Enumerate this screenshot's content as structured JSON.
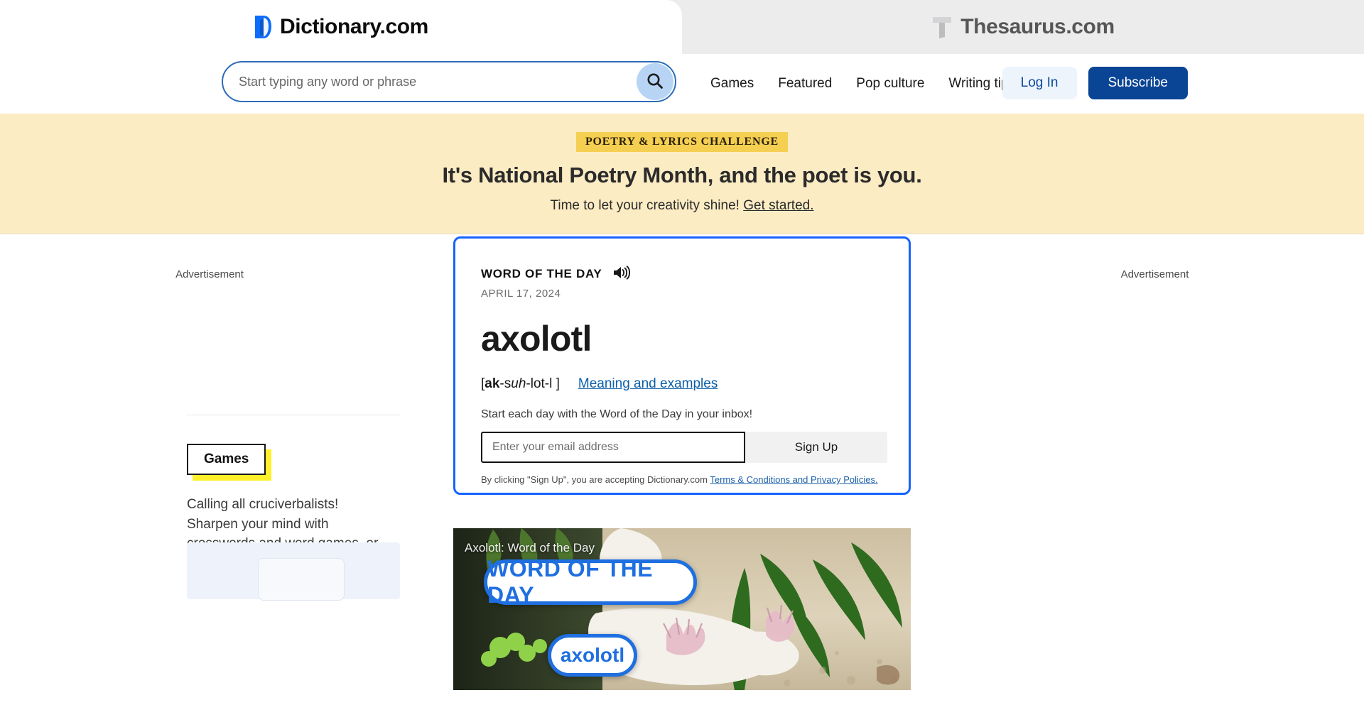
{
  "tabs": [
    {
      "label": "Dictionary.com",
      "icon": "dictionary-logo-icon",
      "active": true
    },
    {
      "label": "Thesaurus.com",
      "icon": "thesaurus-logo-icon",
      "active": false
    }
  ],
  "search": {
    "placeholder": "Start typing any word or phrase",
    "value": "",
    "icon": "search-icon"
  },
  "nav": {
    "links": [
      {
        "label": "Games"
      },
      {
        "label": "Featured"
      },
      {
        "label": "Pop culture"
      },
      {
        "label": "Writing tips"
      }
    ],
    "login_label": "Log In",
    "subscribe_label": "Subscribe"
  },
  "promo": {
    "badge": "POETRY & LYRICS CHALLENGE",
    "title": "It's National Poetry Month, and the poet is you.",
    "subtitle": "Time to let your creativity shine!",
    "cta": "Get started.",
    "background": "#fcecc4",
    "badge_background": "#f5cf52",
    "close_icon": "close-icon"
  },
  "ads": {
    "left_label": "Advertisement",
    "right_label": "Advertisement"
  },
  "sidebar": {
    "badge_label": "Games",
    "badge_accent": "#fff02b",
    "body": "Calling all cruciverbalists! Sharpen your mind with crosswords and word games, or take a brain break with your favorite classic games."
  },
  "word_of_the_day": {
    "kicker": "WORD OF THE DAY",
    "audio_icon": "speaker-icon",
    "date": "APRIL 17, 2024",
    "word": "axolotl",
    "pron_open": "[",
    "pron_bold": "ak",
    "pron_mid1": "-s",
    "pron_italic": "uh",
    "pron_mid2": "-lot-l ]",
    "meaning_link": "Meaning and examples",
    "newsletter_prompt": "Start each day with the Word of the Day in your inbox!",
    "email_placeholder": "Enter your email address",
    "email_value": "",
    "signup_label": "Sign Up",
    "terms_prefix": "By clicking \"Sign Up\", you are accepting Dictionary.com ",
    "terms_link": "Terms & Conditions and Privacy Policies.",
    "border_color": "#1463ff"
  },
  "video": {
    "title": "Axolotl: Word of the Day",
    "pill_primary": "WORD OF THE DAY",
    "pill_secondary": "axolotl",
    "accent": "#1f6fe0"
  }
}
